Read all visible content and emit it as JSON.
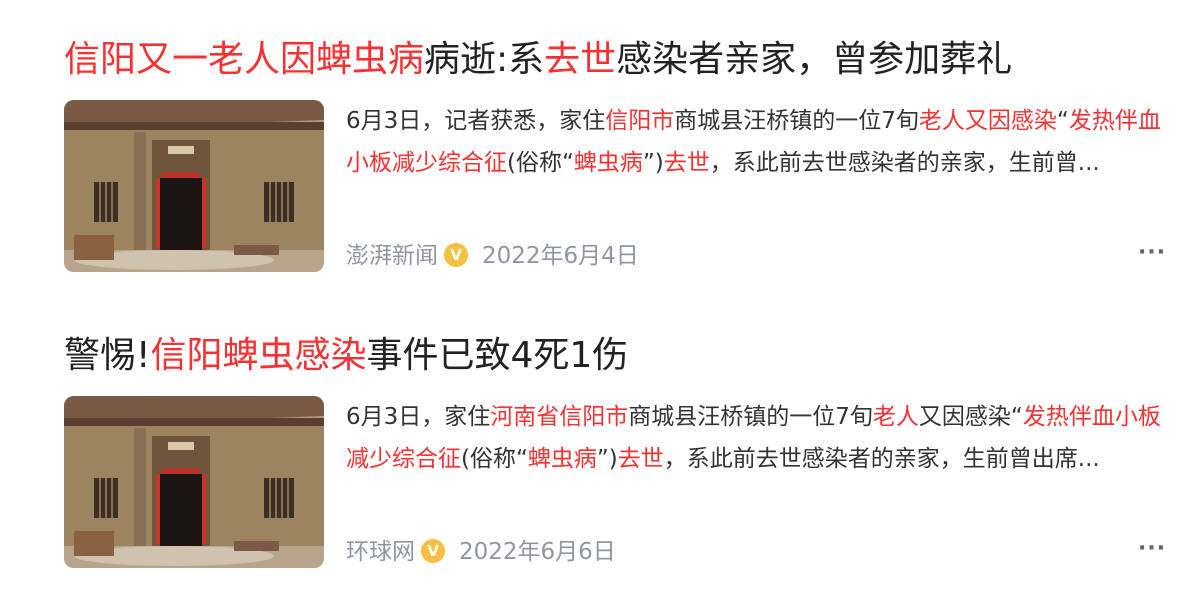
{
  "results": [
    {
      "title_parts": [
        {
          "text": "信阳又一老人因蜱虫病",
          "hl": true
        },
        {
          "text": "病逝:系",
          "hl": false
        },
        {
          "text": "去世",
          "hl": true
        },
        {
          "text": "感染者亲家，曾参加葬礼",
          "hl": false
        }
      ],
      "snippet_parts": [
        {
          "text": "6月3日，记者获悉，家住",
          "hl": false
        },
        {
          "text": "信阳市",
          "hl": true
        },
        {
          "text": "商城县汪桥镇的一位7旬",
          "hl": false
        },
        {
          "text": "老人又因感染",
          "hl": true
        },
        {
          "text": "“",
          "hl": false
        },
        {
          "text": "发热伴血小板减少综合征",
          "hl": true
        },
        {
          "text": "(俗称“",
          "hl": false
        },
        {
          "text": "蜱虫病",
          "hl": true
        },
        {
          "text": "”)",
          "hl": false
        },
        {
          "text": "去世",
          "hl": true
        },
        {
          "text": "，系此前去世感染者的亲家，生前曾...",
          "hl": false
        }
      ],
      "source": "澎湃新闻",
      "verified_badge": "V",
      "date": "2022年6月4日",
      "more_label": "···"
    },
    {
      "title_parts": [
        {
          "text": "警惕!",
          "hl": false
        },
        {
          "text": "信阳蜱虫感染",
          "hl": true
        },
        {
          "text": "事件已致4死1伤",
          "hl": false
        }
      ],
      "snippet_parts": [
        {
          "text": "6月3日，家住",
          "hl": false
        },
        {
          "text": "河南省信阳市",
          "hl": true
        },
        {
          "text": "商城县汪桥镇的一位7旬",
          "hl": false
        },
        {
          "text": "老人",
          "hl": true
        },
        {
          "text": "又因感染“",
          "hl": false
        },
        {
          "text": "发热伴血小板减少综合征",
          "hl": true
        },
        {
          "text": "(俗称“",
          "hl": false
        },
        {
          "text": "蜱虫病",
          "hl": true
        },
        {
          "text": "”)",
          "hl": false
        },
        {
          "text": "去世",
          "hl": true
        },
        {
          "text": "，系此前去世感染者的亲家，生前曾出席...",
          "hl": false
        }
      ],
      "source": "环球网",
      "verified_badge": "V",
      "date": "2022年6月6日",
      "more_label": "···"
    }
  ],
  "colors": {
    "highlight": "#f73131",
    "title": "#222222",
    "meta": "#9195a3",
    "badge": "#f5c042"
  },
  "thumbnail_icon": "old-farmhouse-photo"
}
